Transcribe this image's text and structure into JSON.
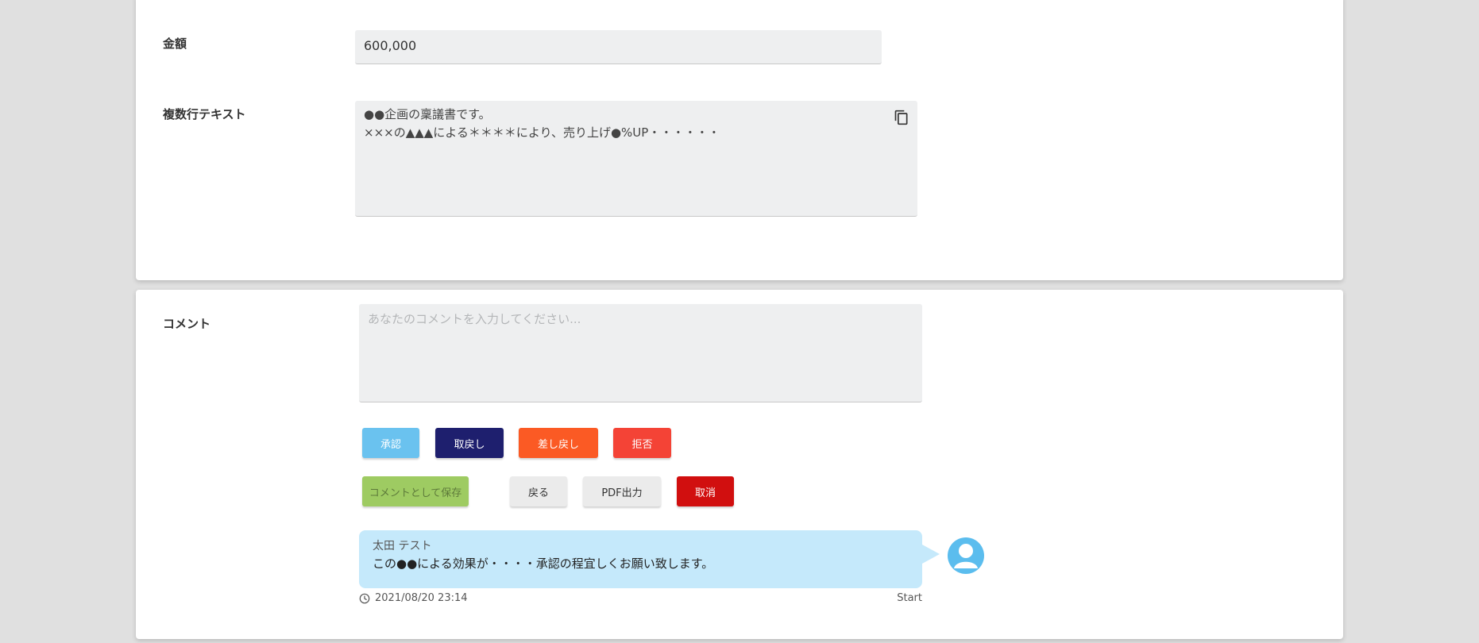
{
  "form": {
    "amount_label": "金額",
    "amount_value": "600,000",
    "multiline_label": "複数行テキスト",
    "multiline_lines": [
      "●●企画の稟議書です。",
      "×××の▲▲▲による＊＊＊＊により、売り上げ●%UP・・・・・・"
    ]
  },
  "comment": {
    "label": "コメント",
    "placeholder": "あなたのコメントを入力してください..."
  },
  "buttons": {
    "approve": "承認",
    "withdraw": "取戻し",
    "send_back": "差し戻し",
    "reject": "拒否",
    "save_comment": "コメントとして保存",
    "back": "戻る",
    "pdf_export": "PDF出力",
    "cancel": "取消"
  },
  "history": [
    {
      "author": "太田 テスト",
      "text": "この●●による効果が・・・・承認の程宜しくお願い致します。",
      "timestamp": "2021/08/20 23:14",
      "status": "Start"
    }
  ],
  "icons": {
    "copy": "copy-icon",
    "clock": "clock-icon",
    "avatar": "user-avatar-icon"
  },
  "colors": {
    "approve": "#6ac2ef",
    "withdraw": "#1e1f6e",
    "send_back": "#fb5a24",
    "reject": "#f44336",
    "save_comment": "#9ecb62",
    "neutral": "#ebebeb",
    "cancel": "#d10f0f",
    "bubble": "#c5e9fb",
    "avatar": "#5bbdee"
  }
}
